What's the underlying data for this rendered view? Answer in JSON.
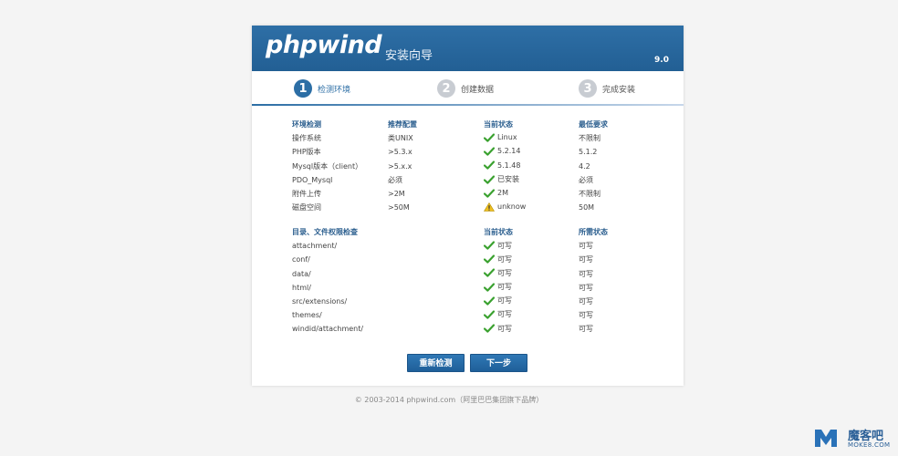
{
  "header": {
    "logo": "phpwind",
    "subtitle": "安装向导",
    "version": "9.0"
  },
  "steps": [
    {
      "num": "1",
      "label": "检测环境",
      "active": true
    },
    {
      "num": "2",
      "label": "创建数据",
      "active": false
    },
    {
      "num": "3",
      "label": "完成安装",
      "active": false
    }
  ],
  "env": {
    "headers": [
      "环境检测",
      "推荐配置",
      "当前状态",
      "最低要求"
    ],
    "rows": [
      {
        "name": "操作系统",
        "recommended": "类UNIX",
        "status": "Linux",
        "status_icon": "check-icon",
        "minimum": "不限制"
      },
      {
        "name": "PHP版本",
        "recommended": ">5.3.x",
        "status": "5.2.14",
        "status_icon": "check-icon",
        "minimum": "5.1.2"
      },
      {
        "name": "Mysql版本（client）",
        "recommended": ">5.x.x",
        "status": "5.1.48",
        "status_icon": "check-icon",
        "minimum": "4.2"
      },
      {
        "name": "PDO_Mysql",
        "recommended": "必须",
        "status": "已安装",
        "status_icon": "check-icon",
        "minimum": "必须"
      },
      {
        "name": "附件上传",
        "recommended": ">2M",
        "status": "2M",
        "status_icon": "check-icon",
        "minimum": "不限制"
      },
      {
        "name": "磁盘空间",
        "recommended": ">50M",
        "status": "unknow",
        "status_icon": "warning-icon",
        "minimum": "50M"
      }
    ]
  },
  "dirs": {
    "headers": [
      "目录、文件权限检查",
      "",
      "当前状态",
      "所需状态"
    ],
    "rows": [
      {
        "name": "attachment/",
        "status": "可写",
        "status_icon": "check-icon",
        "required": "可写"
      },
      {
        "name": "conf/",
        "status": "可写",
        "status_icon": "check-icon",
        "required": "可写"
      },
      {
        "name": "data/",
        "status": "可写",
        "status_icon": "check-icon",
        "required": "可写"
      },
      {
        "name": "html/",
        "status": "可写",
        "status_icon": "check-icon",
        "required": "可写"
      },
      {
        "name": "src/extensions/",
        "status": "可写",
        "status_icon": "check-icon",
        "required": "可写"
      },
      {
        "name": "themes/",
        "status": "可写",
        "status_icon": "check-icon",
        "required": "可写"
      },
      {
        "name": "windid/attachment/",
        "status": "可写",
        "status_icon": "check-icon",
        "required": "可写"
      }
    ]
  },
  "buttons": {
    "recheck": "重新检测",
    "next": "下一步"
  },
  "footer": "© 2003-2014 phpwind.com（阿里巴巴集团旗下品牌）",
  "watermark": {
    "name": "魔客吧",
    "domain": "MOKE8.COM"
  },
  "colors": {
    "accent": "#2c6ea5",
    "check": "#3aa12f",
    "warning": "#f0c020"
  }
}
